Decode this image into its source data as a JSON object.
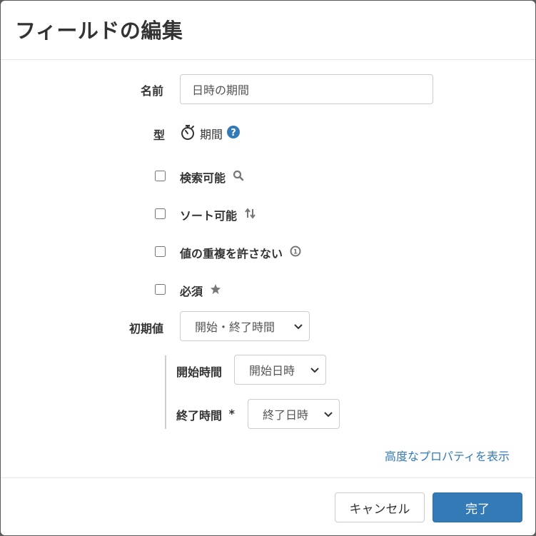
{
  "dialog": {
    "title": "フィールドの編集"
  },
  "form": {
    "name_label": "名前",
    "name_value": "日時の期間",
    "type_label": "型",
    "type_value": "期間",
    "checkboxes": [
      {
        "label": "検索可能",
        "icon": "search-icon",
        "checked": false
      },
      {
        "label": "ソート可能",
        "icon": "sort-icon",
        "checked": false
      },
      {
        "label": "値の重複を許さない",
        "icon": "unique-icon",
        "checked": false
      },
      {
        "label": "必須",
        "icon": "star-icon",
        "checked": false
      }
    ],
    "default_label": "初期値",
    "default_value": "開始・終了時間",
    "start_label": "開始時間",
    "start_value": "開始日時",
    "end_label": "終了時間",
    "end_required_mark": "*",
    "end_value": "終了日時",
    "advanced_link": "高度なプロパティを表示"
  },
  "footer": {
    "cancel_label": "キャンセル",
    "done_label": "完了"
  },
  "colors": {
    "primary": "#337ab7",
    "link": "#337ab7"
  }
}
